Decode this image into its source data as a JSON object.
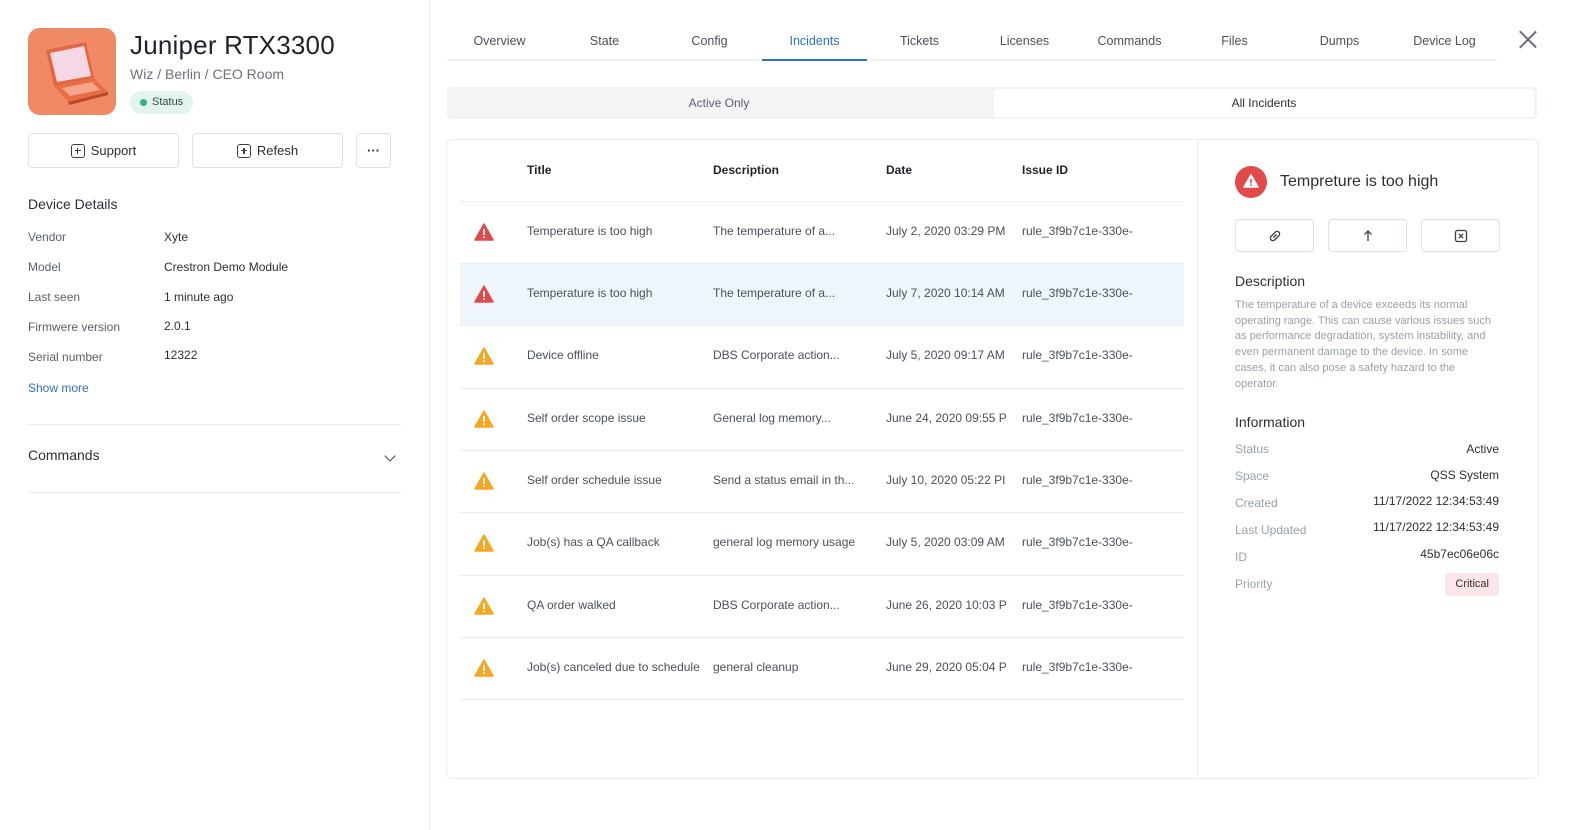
{
  "device": {
    "title": "Juniper RTX3300",
    "path": "Wiz / Berlin / CEO Room",
    "status_label": "Status",
    "buttons": {
      "support": "Support",
      "refresh": "Refesh",
      "more": "···"
    },
    "details_heading": "Device Details",
    "details": [
      {
        "key": "Vendor",
        "value": "Xyte"
      },
      {
        "key": "Model",
        "value": "Crestron Demo Module"
      },
      {
        "key": "Last seen",
        "value": "1 minute ago"
      },
      {
        "key": "Firmwere version",
        "value": "2.0.1"
      },
      {
        "key": "Serial number",
        "value": "12322"
      }
    ],
    "show_more": "Show more",
    "commands_heading": "Commands"
  },
  "tabs": [
    "Overview",
    "State",
    "Config",
    "Incidents",
    "Tickets",
    "Licenses",
    "Commands",
    "Files",
    "Dumps",
    "Device Log"
  ],
  "active_tab": "Incidents",
  "filter": {
    "active_only": "Active Only",
    "all_incidents": "All Incidents",
    "selected": "All Incidents"
  },
  "table": {
    "headers": {
      "title": "Title",
      "description": "Description",
      "date": "Date",
      "issue_id": "Issue ID"
    },
    "rows": [
      {
        "severity": "critical",
        "title": "Temperature is too high",
        "description": "The temperature of a...",
        "date": "July 2, 2020 03:29 PM",
        "issue_id": "rule_3f9b7c1e-330e-"
      },
      {
        "severity": "critical",
        "title": "Temperature is too high",
        "description": "The temperature of a...",
        "date": "July 7, 2020 10:14 AM",
        "issue_id": "rule_3f9b7c1e-330e-",
        "selected": true
      },
      {
        "severity": "warning",
        "title": "Device offline",
        "description": "DBS Corporate action...",
        "date": "July 5, 2020 09:17 AM",
        "issue_id": "rule_3f9b7c1e-330e-"
      },
      {
        "severity": "warning",
        "title": "Self order scope issue",
        "description": "General log memory...",
        "date": "June 24, 2020 09:55 P",
        "issue_id": "rule_3f9b7c1e-330e-"
      },
      {
        "severity": "warning",
        "title": "Self order schedule issue",
        "description": "Send a status email in th...",
        "date": "July 10, 2020 05:22 PI",
        "issue_id": "rule_3f9b7c1e-330e-"
      },
      {
        "severity": "warning",
        "title": "Job(s) has a QA callback",
        "description": "general log memory usage",
        "date": "July 5, 2020 03:09 AM",
        "issue_id": "rule_3f9b7c1e-330e-"
      },
      {
        "severity": "warning",
        "title": "QA order walked",
        "description": "DBS Corporate action...",
        "date": "June 26, 2020 10:03 P",
        "issue_id": "rule_3f9b7c1e-330e-"
      },
      {
        "severity": "warning",
        "title": "Job(s) canceled due to schedule",
        "description": "general cleanup",
        "date": "June 29, 2020 05:04 P",
        "issue_id": "rule_3f9b7c1e-330e-"
      }
    ]
  },
  "detail": {
    "title": "Tempreture is too high",
    "actions": [
      "link-icon",
      "arrow-up-icon",
      "close-square-icon"
    ],
    "description_heading": "Description",
    "description": "The temperature of a device exceeds its normal operating range. This can cause various issues such as performance degradation, system instability, and even permanent damage to the device. In some cases, it can also pose a safety hazard to the operator.",
    "information_heading": "Information",
    "info": [
      {
        "key": "Status",
        "value": "Active"
      },
      {
        "key": "Space",
        "value": "QSS System"
      },
      {
        "key": "Created",
        "value": "11/17/2022 12:34:53:49"
      },
      {
        "key": "Last Updated",
        "value": "11/17/2022 12:34:53:49"
      },
      {
        "key": "ID",
        "value": "45b7ec06e06c"
      },
      {
        "key": "Priority",
        "value": "Critical"
      }
    ]
  },
  "colors": {
    "accent": "#2d6fcb",
    "critical": "#e24a4a",
    "warning": "#f5a623",
    "selected_row": "#eef6fb",
    "status_dot": "#2fb487"
  }
}
